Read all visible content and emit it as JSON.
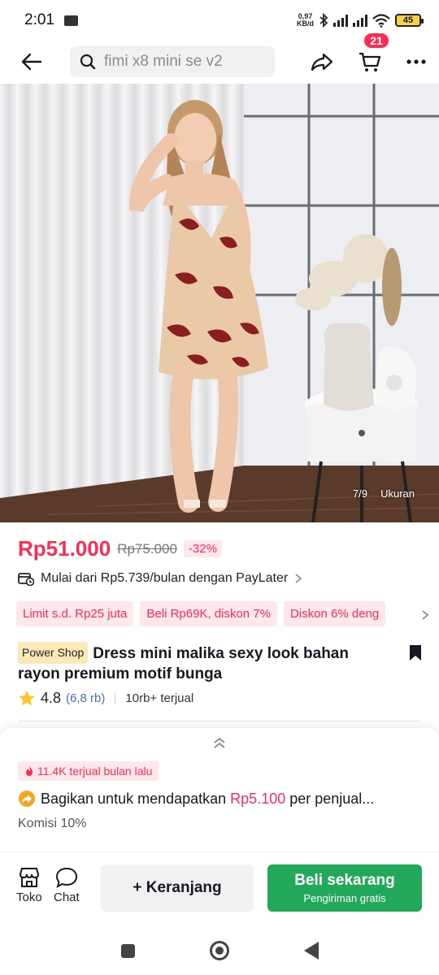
{
  "status": {
    "time": "2:01",
    "net_speed_top": "0,97",
    "net_speed_bottom": "KB/d",
    "battery": "45"
  },
  "nav": {
    "search_query": "fimi x8 mini se v2",
    "cart_count": "21"
  },
  "gallery": {
    "counter": "7/9",
    "size_label": "Ukuran"
  },
  "product": {
    "price": "Rp51.000",
    "original_price": "Rp75.000",
    "discount": "-32%",
    "paylater": "Mulai dari Rp5.739/bulan dengan PayLater",
    "promos": [
      "Limit s.d. Rp25 juta",
      "Beli Rp69K, diskon 7%",
      "Diskon 6% deng"
    ],
    "shop_badge": "Power Shop",
    "title": "Dress mini malika sexy look bahan rayon premium motif bunga",
    "rating": "4.8",
    "rating_count": "(6,8 rb)",
    "sold": "10rb+ terjual"
  },
  "sheet": {
    "sold_month": "11.4K terjual bulan lalu",
    "share_prefix": "Bagikan untuk mendapatkan ",
    "share_amount": "Rp5.100",
    "share_suffix": " per penjual...",
    "commission": "Komisi 10%"
  },
  "actions": {
    "shop_label": "Toko",
    "chat_label": "Chat",
    "add_cart": "+ Keranjang",
    "buy_now": "Beli sekarang",
    "buy_sub": "Pengiriman gratis"
  },
  "colors": {
    "accent": "#fe2c55",
    "buy_green": "#22a85a"
  }
}
